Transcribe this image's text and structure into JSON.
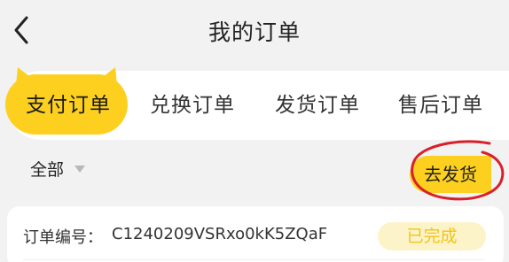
{
  "header": {
    "title": "我的订单",
    "back_icon": "chevron-left-icon"
  },
  "tabs": [
    {
      "label": "支付订单",
      "active": true
    },
    {
      "label": "兑换订单",
      "active": false
    },
    {
      "label": "发货订单",
      "active": false
    },
    {
      "label": "售后订单",
      "active": false
    }
  ],
  "filter": {
    "label": "全部",
    "icon": "caret-down-icon"
  },
  "actions": {
    "ship_label": "去发货"
  },
  "order": {
    "number_label": "订单编号：",
    "number": "C1240209VSRxo0kK5ZQaF",
    "status": "已完成"
  },
  "colors": {
    "accent": "#fdd020",
    "status_bg": "#fdf3c9",
    "status_text": "#f0c419",
    "annotation": "#d9202a",
    "background": "#f2f2f2"
  }
}
